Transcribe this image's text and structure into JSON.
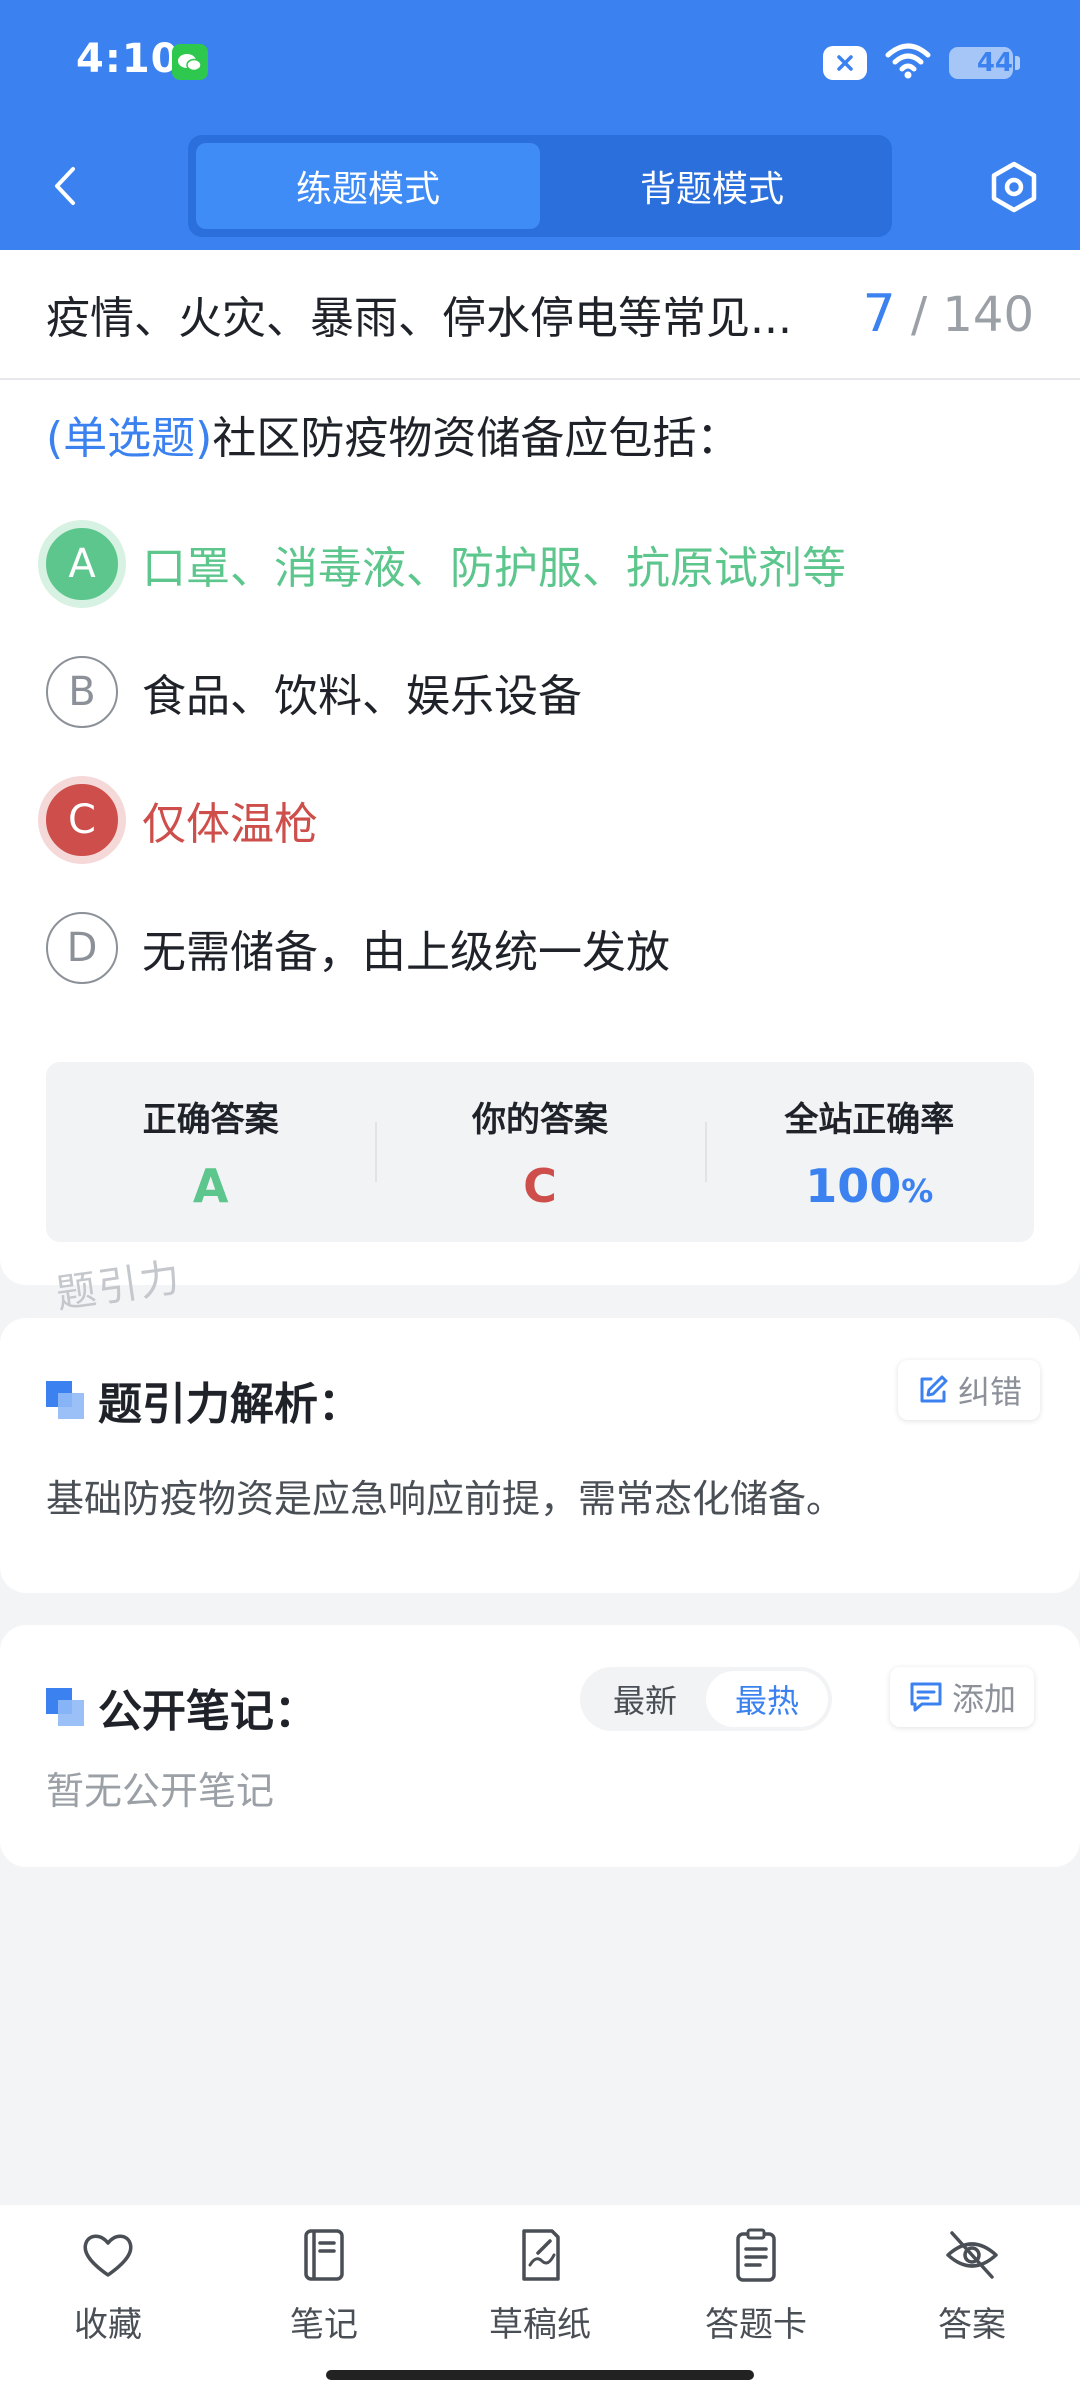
{
  "status_bar": {
    "time": "4:10",
    "battery": "44",
    "battery_level": 0.44
  },
  "nav": {
    "tabs": [
      {
        "label": "练题模式",
        "active": true
      },
      {
        "label": "背题模式",
        "active": false
      }
    ]
  },
  "question": {
    "category_title": "疫情、火灾、暴雨、停水停电等常见...",
    "current": "7",
    "total": "/ 140",
    "type_label": "(单选题)",
    "stem": "社区防疫物资储备应包括：",
    "options": [
      {
        "letter": "A",
        "text": "口罩、消毒液、防护服、抗原试剂等",
        "state": "correct"
      },
      {
        "letter": "B",
        "text": "食品、饮料、娱乐设备",
        "state": "normal"
      },
      {
        "letter": "C",
        "text": "仅体温枪",
        "state": "wrong"
      },
      {
        "letter": "D",
        "text": "无需储备，由上级统一发放",
        "state": "normal"
      }
    ]
  },
  "answer_panel": {
    "correct_label": "正确答案",
    "correct_value": "A",
    "yours_label": "你的答案",
    "yours_value": "C",
    "rate_label": "全站正确率",
    "rate_value": "100",
    "rate_unit": "%"
  },
  "watermark": "题引力",
  "analysis": {
    "title": "题引力解析：",
    "report_label": "纠错",
    "text": "基础防疫物资是应急响应前提，需常态化储备。"
  },
  "notes": {
    "title": "公开笔记：",
    "sort_options": [
      {
        "label": "最新",
        "active": false
      },
      {
        "label": "最热",
        "active": true
      }
    ],
    "add_label": "添加",
    "empty_text": "暂无公开笔记"
  },
  "toolbar": {
    "items": [
      {
        "label": "收藏",
        "icon": "heart-icon"
      },
      {
        "label": "笔记",
        "icon": "notebook-icon"
      },
      {
        "label": "草稿纸",
        "icon": "draft-paper-icon"
      },
      {
        "label": "答题卡",
        "icon": "answer-sheet-icon"
      },
      {
        "label": "答案",
        "icon": "eye-off-icon"
      }
    ]
  },
  "colors": {
    "primary": "#3b82f0",
    "correct": "#5cc68d",
    "wrong": "#cd4e4a"
  }
}
